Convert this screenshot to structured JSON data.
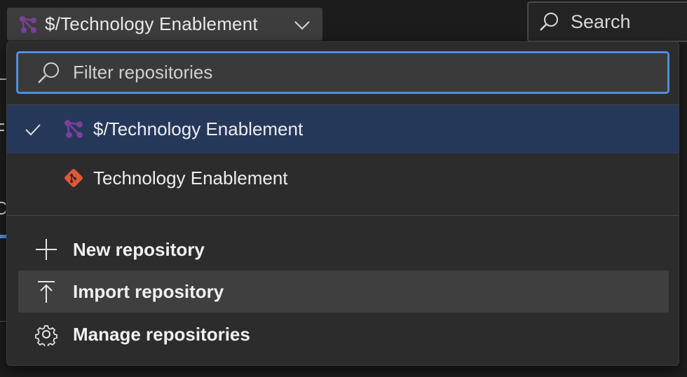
{
  "header": {
    "repo_selector_label": "$/Technology Enablement",
    "search_label": "Search"
  },
  "dropdown": {
    "filter_placeholder": "Filter repositories",
    "repositories": [
      {
        "label": "$/Technology Enablement",
        "type": "tfvc",
        "selected": true
      },
      {
        "label": "Technology Enablement",
        "type": "git",
        "selected": false
      }
    ],
    "actions": [
      {
        "label": "New repository",
        "icon": "plus-icon"
      },
      {
        "label": "Import repository",
        "icon": "import-icon"
      },
      {
        "label": "Manage repositories",
        "icon": "gear-icon"
      }
    ]
  },
  "background_fragments": {
    "frag_a": "F",
    "frag_b": "Co"
  },
  "colors": {
    "accent": "#4f8fdb",
    "selected_row": "#26385a",
    "tfvc_icon": "#7a3f9d",
    "git_icon": "#e0573a"
  }
}
